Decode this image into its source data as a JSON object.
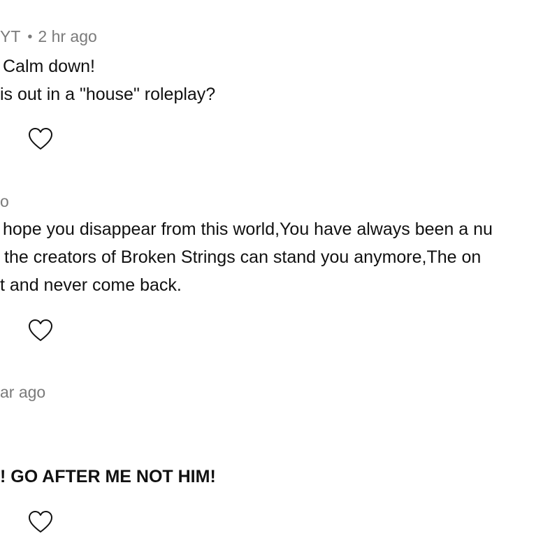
{
  "comments": [
    {
      "author_fragment": "YT",
      "separator": "•",
      "time": "2 hr ago",
      "lines": [
        "Calm down!",
        "is out in a \"house\" roleplay?"
      ],
      "like_icon": "heart-outline-icon"
    },
    {
      "author_fragment": "o",
      "lines": [
        "hope you disappear from this world,You have always been a nu",
        "the creators of Broken Strings can stand you anymore,The on",
        "t and never come back."
      ],
      "like_icon": "heart-outline-icon"
    },
    {
      "time": "ar ago",
      "lines": [
        "! GO AFTER ME NOT HIM!"
      ],
      "like_icon": "heart-outline-icon"
    }
  ]
}
